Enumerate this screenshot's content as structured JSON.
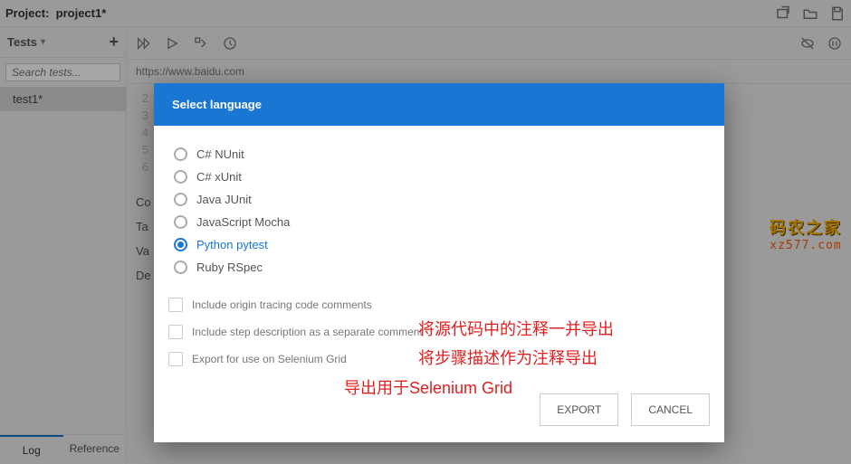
{
  "project": {
    "label": "Project:",
    "name": "project1*"
  },
  "sidebar": {
    "tests_label": "Tests",
    "search_placeholder": "Search tests...",
    "items": [
      "test1*"
    ],
    "tabs": {
      "log": "Log",
      "reference": "Reference"
    }
  },
  "url": "https://www.baidu.com",
  "steps": {
    "nums": [
      "2",
      "3",
      "4",
      "5",
      "6"
    ]
  },
  "sections": {
    "co": "Co",
    "ta": "Ta",
    "va": "Va",
    "de": "De"
  },
  "dialog": {
    "title": "Select language",
    "options": [
      "C# NUnit",
      "C# xUnit",
      "Java JUnit",
      "JavaScript Mocha",
      "Python pytest",
      "Ruby RSpec"
    ],
    "selected": 4,
    "checkboxes": [
      "Include origin tracing code comments",
      "Include step description as a separate comment",
      "Export for use on Selenium Grid"
    ],
    "export": "EXPORT",
    "cancel": "CANCEL"
  },
  "annotations": [
    "将源代码中的注释一并导出",
    "将步骤描述作为注释导出",
    "导出用于Selenium Grid"
  ],
  "watermark": {
    "line1": "码农之家",
    "line2": "xz577.com"
  }
}
